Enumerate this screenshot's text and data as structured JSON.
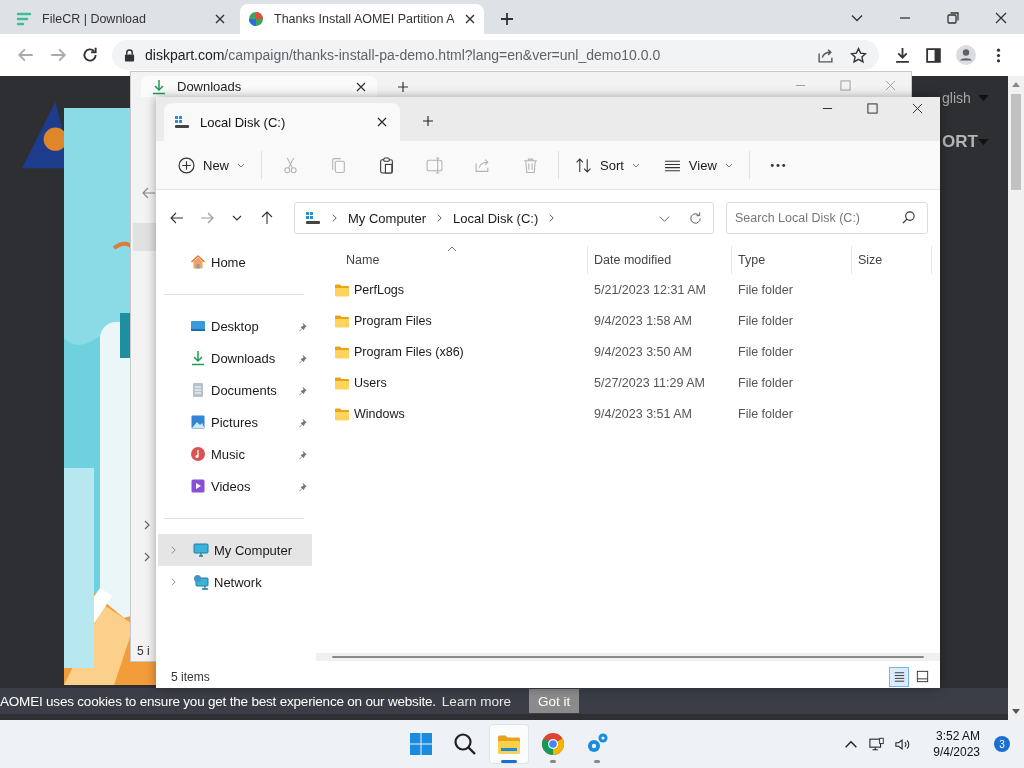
{
  "browser": {
    "tabs": [
      {
        "title": "FileCR | Download",
        "kind": "filecr",
        "selected": false
      },
      {
        "title": "Thanks Install AOMEI Partition A",
        "kind": "aomei",
        "selected": true
      }
    ],
    "address": {
      "host": "diskpart.com",
      "path": "/campaign/thanks-install-pa-demo.html?lang=en&ver=unl_demo10.0.0"
    }
  },
  "web_page": {
    "language": "glish",
    "nav_item": "ORT",
    "cookie_notice": {
      "message": "AOMEI uses cookies to ensure you get the best experience on our website.",
      "link": "Learn more",
      "button": "Got it"
    }
  },
  "downloads_window": {
    "tab": "Downloads",
    "status": "5 i"
  },
  "explorer": {
    "tab": "Local Disk (C:)",
    "toolbar": [
      [
        {
          "kind": "new",
          "label": "New",
          "disabled": false
        }
      ],
      [
        {
          "kind": "cut",
          "disabled": true
        },
        {
          "kind": "copy",
          "disabled": true
        },
        {
          "kind": "paste",
          "disabled": false
        },
        {
          "kind": "rename",
          "disabled": true
        },
        {
          "kind": "share",
          "disabled": true
        },
        {
          "kind": "delete",
          "disabled": true
        }
      ],
      [
        {
          "kind": "sort",
          "label": "Sort",
          "disabled": false
        },
        {
          "kind": "view",
          "label": "View",
          "disabled": false
        }
      ],
      [
        {
          "kind": "more",
          "disabled": false
        }
      ]
    ],
    "breadcrumbs": [
      "My Computer",
      "Local Disk (C:)"
    ],
    "search": {
      "placeholder": "Search Local Disk (C:)"
    },
    "home": {
      "label": "Home"
    },
    "quick_access": [
      {
        "kind": "desktop",
        "label": "Desktop",
        "pinned": true
      },
      {
        "kind": "downloads",
        "label": "Downloads",
        "pinned": true
      },
      {
        "kind": "documents",
        "label": "Documents",
        "pinned": true
      },
      {
        "kind": "pictures",
        "label": "Pictures",
        "pinned": true
      },
      {
        "kind": "music",
        "label": "Music",
        "pinned": true
      },
      {
        "kind": "videos",
        "label": "Videos",
        "pinned": true
      }
    ],
    "tree": [
      {
        "kind": "computer",
        "label": "My Computer",
        "selected": true
      },
      {
        "kind": "network",
        "label": "Network",
        "selected": false
      }
    ],
    "columns": [
      {
        "label": "Name",
        "sorted": true
      },
      {
        "label": "Date modified",
        "sorted": false
      },
      {
        "label": "Type",
        "sorted": false
      },
      {
        "label": "Size",
        "sorted": false
      }
    ],
    "rows": [
      {
        "name": "PerfLogs",
        "date_modified": "5/21/2023 12:31 AM",
        "type": "File folder"
      },
      {
        "name": "Program Files",
        "date_modified": "9/4/2023 1:58 AM",
        "type": "File folder"
      },
      {
        "name": "Program Files (x86)",
        "date_modified": "9/4/2023 3:50 AM",
        "type": "File folder"
      },
      {
        "name": "Users",
        "date_modified": "5/27/2023 11:29 AM",
        "type": "File folder"
      },
      {
        "name": "Windows",
        "date_modified": "9/4/2023 3:51 AM",
        "type": "File folder"
      }
    ],
    "status": "5 items",
    "views": [
      {
        "kind": "details",
        "selected": true
      },
      {
        "kind": "tiles",
        "selected": false
      }
    ]
  },
  "taskbar": {
    "apps": [
      {
        "kind": "start",
        "running": false,
        "selected": false
      },
      {
        "kind": "search",
        "running": false,
        "selected": false
      },
      {
        "kind": "explorer",
        "running": true,
        "selected": true
      },
      {
        "kind": "chrome",
        "running": true,
        "selected": false
      },
      {
        "kind": "gears",
        "running": true,
        "selected": false
      }
    ],
    "time": "3:52 AM",
    "date": "9/4/2023",
    "notifications": "3"
  }
}
